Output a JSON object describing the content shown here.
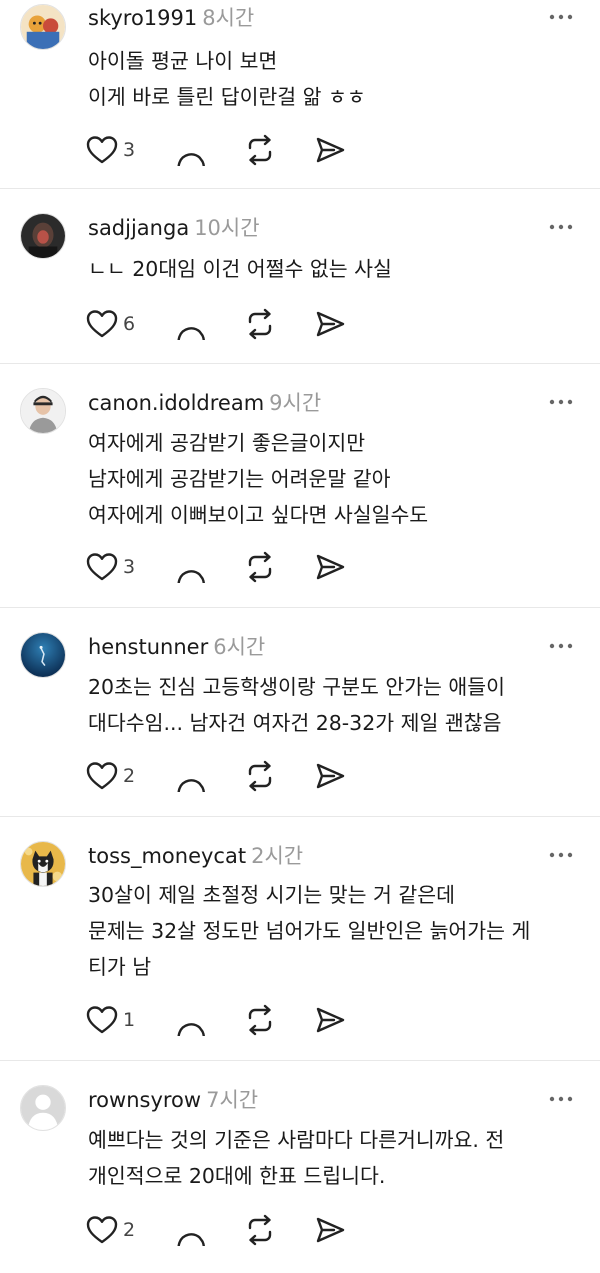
{
  "posts": [
    {
      "username": "skyro1991",
      "time": "8시간",
      "body": "아이돌 평균 나이 보면\n이게 바로 틀린 답이란걸 앎 ㅎㅎ",
      "likes": "3",
      "avatar": "cartoon-avatar"
    },
    {
      "username": "sadjjanga",
      "time": "10시간",
      "body": "ㄴㄴ 20대임 이건 어쩔수 없는 사실",
      "likes": "6",
      "avatar": "dark-photo-avatar"
    },
    {
      "username": "canon.idoldream",
      "time": "9시간",
      "body": "여자에게 공감받기 좋은글이지만\n남자에게 공감받기는 어려운말 같아\n여자에게 이뻐보이고 싶다면 사실일수도",
      "likes": "3",
      "avatar": "person-photo-avatar"
    },
    {
      "username": "henstunner",
      "time": "6시간",
      "body": "20초는 진심 고등학생이랑 구분도 안가는 애들이\n대다수임... 남자건 여자건 28-32가 제일 괜찮음",
      "likes": "2",
      "avatar": "underwater-avatar"
    },
    {
      "username": "toss_moneycat",
      "time": "2시간",
      "body": "30살이 제일 초절정 시기는 맞는 거 같은데\n문제는 32살 정도만 넘어가도 일반인은 늙어가는 게\n티가 남",
      "likes": "1",
      "avatar": "cat-avatar"
    },
    {
      "username": "rownsyrow",
      "time": "7시간",
      "body": "예쁘다는 것의 기준은 사람마다 다른거니까요. 전\n개인적으로 20대에 한표 드립니다.",
      "likes": "2",
      "avatar": "default-avatar"
    }
  ],
  "icons": {
    "more": "more-dots-icon",
    "like": "heart-icon",
    "reply": "comment-bubble-icon",
    "repost": "repost-icon",
    "share": "send-icon"
  },
  "colors": {
    "text": "#1a1a1a",
    "muted": "#9a9a9a",
    "divider": "#e8e8e8"
  }
}
